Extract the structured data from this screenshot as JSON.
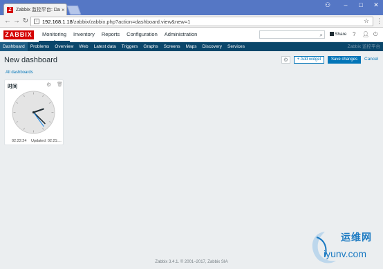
{
  "browser": {
    "tab_title": "Zabbix 监控平台: Dashb",
    "tab_favicon": "Z",
    "tab_close": "×",
    "url_host": "192.168.1.18",
    "url_path": "/zabbix/zabbix.php?action=dashboard.view&new=1"
  },
  "header": {
    "logo": "ZABBIX",
    "nav": [
      "Monitoring",
      "Inventory",
      "Reports",
      "Configuration",
      "Administration"
    ],
    "share": "Share",
    "help": "?",
    "user_icon": "user-icon",
    "power_icon": "power-icon"
  },
  "subnav": {
    "items": [
      "Dashboard",
      "Problems",
      "Overview",
      "Web",
      "Latest data",
      "Triggers",
      "Graphs",
      "Screens",
      "Maps",
      "Discovery",
      "Services"
    ],
    "brand": "Zabbix 监控平台"
  },
  "dashboard": {
    "title": "New dashboard",
    "add_widget": "+ Add widget",
    "save": "Save changes",
    "cancel": "Cancel",
    "breadcrumb": "All dashboards"
  },
  "widget": {
    "title": "时间",
    "time": "02:22:24",
    "updated": "Updated: 02:21:..."
  },
  "clock": {
    "hour": 2,
    "minute": 22,
    "second": 24
  },
  "footer": "Zabbix 3.4.1. © 2001–2017, Zabbix SIA",
  "watermark": {
    "cn": "运维网",
    "url": "iyunv.com"
  },
  "colors": {
    "brand_red": "#d40000",
    "nav_dark": "#0a466a",
    "link_blue": "#0275b8"
  }
}
